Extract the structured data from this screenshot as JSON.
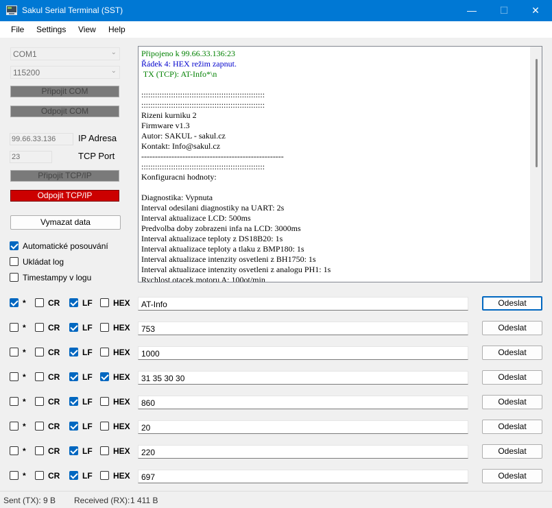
{
  "window": {
    "title": "Sakul Serial Terminal (SST)",
    "minimize": "—",
    "maximize": "☐",
    "close": "✕"
  },
  "menu": [
    "File",
    "Settings",
    "View",
    "Help"
  ],
  "left": {
    "port": "COM1",
    "baud": "115200",
    "connect_com": "Připojit COM",
    "disconnect_com": "Odpojit COM",
    "ip_value": "99.66.33.136",
    "ip_label": "IP Adresa",
    "port_value": "23",
    "port_label": "TCP Port",
    "connect_tcp": "Připojit TCP/IP",
    "disconnect_tcp": "Odpojit TCP/IP",
    "clear": "Vymazat data",
    "options": [
      {
        "label": "Automatické posouvání",
        "checked": true
      },
      {
        "label": "Ukládat log",
        "checked": false
      },
      {
        "label": "Timestampy v logu",
        "checked": false
      }
    ]
  },
  "output": {
    "lines": [
      {
        "text": "Připojeno k 99.66.33.136:23",
        "color": "#008000"
      },
      {
        "text": "Řádek 4: HEX režim zapnut.",
        "color": "#0000cc"
      },
      {
        "text": " TX (TCP): AT-Info*\\n",
        "color": "#008000"
      },
      {
        "text": "",
        "color": "#000000"
      },
      {
        "text": "::::::::::::::::::::::::::::::::::::::::::::::::::::::",
        "color": "#000000"
      },
      {
        "text": "::::::::::::::::::::::::::::::::::::::::::::::::::::::",
        "color": "#000000"
      },
      {
        "text": "Rizeni kurniku 2",
        "color": "#000000"
      },
      {
        "text": "Firmware v1.3",
        "color": "#000000"
      },
      {
        "text": "Autor: SAKUL - sakul.cz",
        "color": "#000000"
      },
      {
        "text": "Kontakt: Info@sakul.cz",
        "color": "#000000"
      },
      {
        "text": "----------------------------------------------------",
        "color": "#000000"
      },
      {
        "text": "::::::::::::::::::::::::::::::::::::::::::::::::::::::",
        "color": "#000000"
      },
      {
        "text": "Konfiguracni hodnoty:",
        "color": "#000000"
      },
      {
        "text": "",
        "color": "#000000"
      },
      {
        "text": "Diagnostika: Vypnuta",
        "color": "#000000"
      },
      {
        "text": "Interval odesilani diagnostiky na UART: 2s",
        "color": "#000000"
      },
      {
        "text": "Interval aktualizace LCD: 500ms",
        "color": "#000000"
      },
      {
        "text": "Predvolba doby zobrazeni infa na LCD: 3000ms",
        "color": "#000000"
      },
      {
        "text": "Interval aktualizace teploty z DS18B20: 1s",
        "color": "#000000"
      },
      {
        "text": "Interval aktualizace teploty a tlaku z BMP180: 1s",
        "color": "#000000"
      },
      {
        "text": "Interval aktualizace intenzity osvetleni z BH1750: 1s",
        "color": "#000000"
      },
      {
        "text": "Interval aktualizace intenzity osvetleni z analogu PH1: 1s",
        "color": "#000000"
      },
      {
        "text": "Rychlost otacek motoru A: 100ot/min",
        "color": "#000000"
      }
    ]
  },
  "send_labels": {
    "star": "*",
    "cr": "CR",
    "lf": "LF",
    "hex": "HEX",
    "send": "Odeslat"
  },
  "send_rows": [
    {
      "star": true,
      "cr": false,
      "lf": true,
      "hex": false,
      "value": "AT-Info"
    },
    {
      "star": false,
      "cr": false,
      "lf": true,
      "hex": false,
      "value": "753"
    },
    {
      "star": false,
      "cr": false,
      "lf": true,
      "hex": false,
      "value": "1000"
    },
    {
      "star": false,
      "cr": false,
      "lf": true,
      "hex": true,
      "value": "31 35 30 30"
    },
    {
      "star": false,
      "cr": false,
      "lf": true,
      "hex": false,
      "value": "860"
    },
    {
      "star": false,
      "cr": false,
      "lf": true,
      "hex": false,
      "value": "20"
    },
    {
      "star": false,
      "cr": false,
      "lf": true,
      "hex": false,
      "value": "220"
    },
    {
      "star": false,
      "cr": false,
      "lf": true,
      "hex": false,
      "value": "697"
    }
  ],
  "status": {
    "sent_label": "Sent (TX):",
    "sent_value": "9 B",
    "received_label": "Received (RX):",
    "received_value": "1 411 B"
  }
}
